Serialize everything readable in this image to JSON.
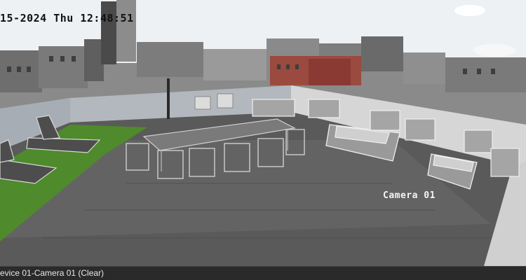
{
  "overlay": {
    "timestamp": "15-2024 Thu 12:48:51",
    "camera_label": "Camera 01"
  },
  "statusbar": {
    "channel_label": "evice 01-Camera 01 (Clear)"
  },
  "colors": {
    "statusbar_bg": "#2a2a2a",
    "status_text": "#e8e8e8",
    "osd_time_text": "#111111",
    "osd_cam_text": "#f4f4f4",
    "turf": "#4f8a2c"
  }
}
